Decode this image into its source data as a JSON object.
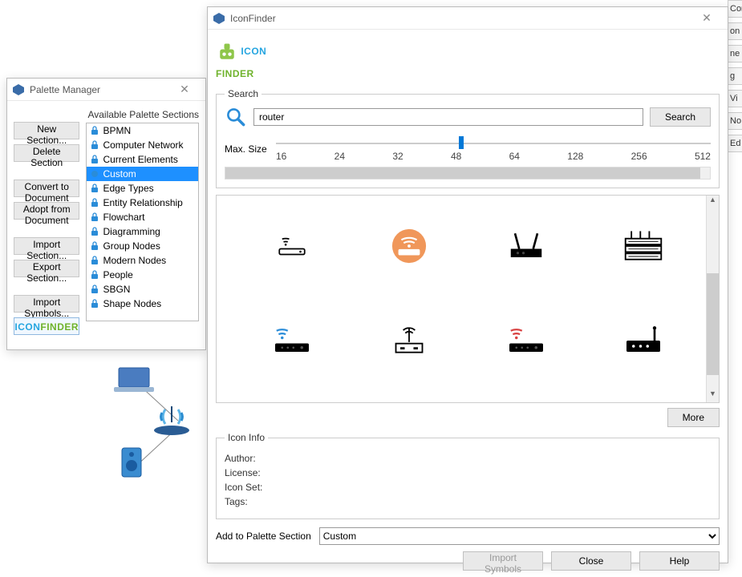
{
  "paletteManager": {
    "title": "Palette Manager",
    "availableLabel": "Available Palette Sections",
    "buttons": {
      "newSection": "New Section...",
      "deleteSection": "Delete Section",
      "convert": "Convert to Document",
      "adopt": "Adopt from Document",
      "importSection": "Import Section...",
      "exportSection": "Export Section...",
      "importSymbols": "Import Symbols..."
    },
    "items": [
      {
        "label": "BPMN",
        "locked": true
      },
      {
        "label": "Computer Network",
        "locked": true
      },
      {
        "label": "Current Elements",
        "locked": true
      },
      {
        "label": "Custom",
        "locked": false,
        "selected": true
      },
      {
        "label": "Edge Types",
        "locked": true
      },
      {
        "label": "Entity Relationship",
        "locked": true
      },
      {
        "label": "Flowchart",
        "locked": true
      },
      {
        "label": "Diagramming",
        "locked": true
      },
      {
        "label": "Group Nodes",
        "locked": true
      },
      {
        "label": "Modern Nodes",
        "locked": true
      },
      {
        "label": "People",
        "locked": true
      },
      {
        "label": "SBGN",
        "locked": true
      },
      {
        "label": "Shape Nodes",
        "locked": true
      }
    ]
  },
  "iconFinder": {
    "title": "IconFinder",
    "search": {
      "legend": "Search",
      "value": "router",
      "button": "Search",
      "maxSizeLabel": "Max. Size",
      "ticks": [
        "16",
        "24",
        "32",
        "48",
        "64",
        "128",
        "256",
        "512"
      ]
    },
    "more": "More",
    "info": {
      "legend": "Icon Info",
      "author": "Author:",
      "license": "License:",
      "iconSet": "Icon Set:",
      "tags": "Tags:"
    },
    "addToPalette": {
      "label": "Add to Palette Section",
      "value": "Custom"
    },
    "buttons": {
      "importSymbols": "Import Symbols",
      "close": "Close",
      "help": "Help"
    },
    "icons": [
      "wifi-router-minimal",
      "wifi-router-orange-circle",
      "router-antennas-black",
      "router-stacked",
      "wifi-router-blue-signal",
      "router-line-antenna",
      "router-red-signal",
      "router-solid-dots"
    ]
  },
  "sideFragments": [
    "Computer",
    "on",
    "ne",
    "g",
    "Vi",
    "No",
    "Ed"
  ]
}
